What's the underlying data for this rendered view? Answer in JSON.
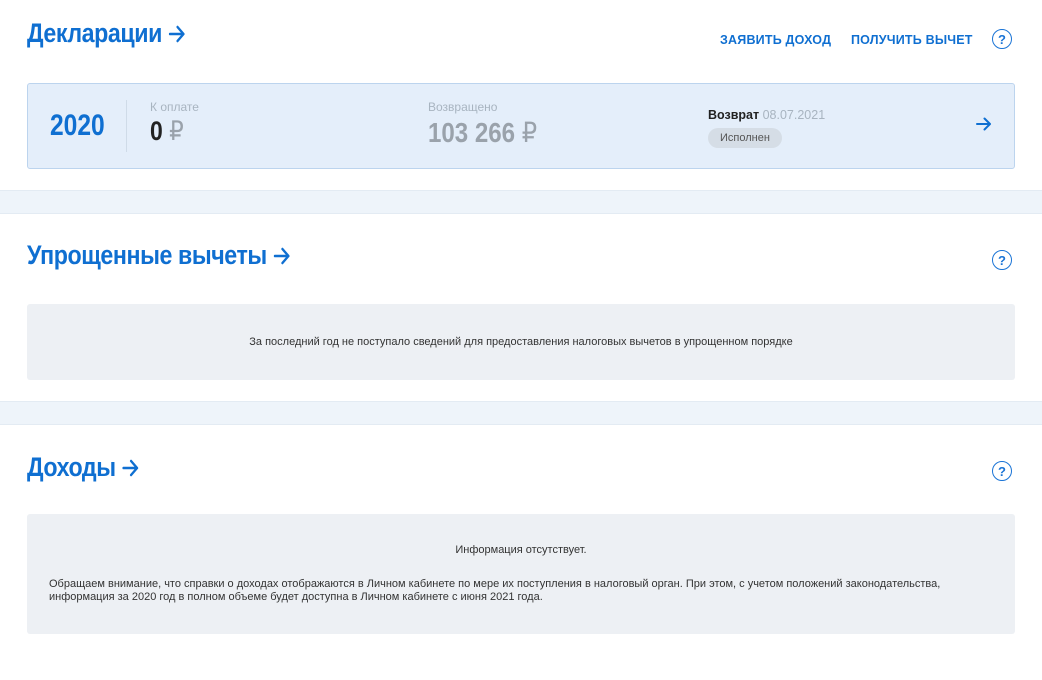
{
  "declarations": {
    "title": "Декларации",
    "links": {
      "declare_income": "ЗАЯВИТЬ ДОХОД",
      "get_deduction": "ПОЛУЧИТЬ ВЫЧЕТ"
    },
    "help_icon": "?",
    "card": {
      "year": "2020",
      "to_pay_label": "К оплате",
      "to_pay_value": "0",
      "returned_label": "Возвращено",
      "returned_value": "103 266",
      "currency": "₽",
      "refund_label": "Возврат",
      "refund_date": "08.07.2021",
      "status": "Исполнен"
    }
  },
  "simplified": {
    "title": "Упрощенные вычеты",
    "help_icon": "?",
    "message": "За последний год не поступало сведений для предоставления налоговых вычетов в упрощенном порядке"
  },
  "income": {
    "title": "Доходы",
    "help_icon": "?",
    "headline": "Информация отсутствует.",
    "message": "Обращаем внимание, что справки о доходах отображаются в Личном кабинете по мере их поступления в налоговый орган. При этом, с учетом положений законодательства, информация за 2020 год в полном объеме будет доступна в Личном кабинете с июня 2021 года."
  },
  "colors": {
    "accent": "#0f6fd1",
    "card_bg": "#e4eefa",
    "info_bg": "#edf0f4",
    "divider_bg": "#eef4fa"
  }
}
